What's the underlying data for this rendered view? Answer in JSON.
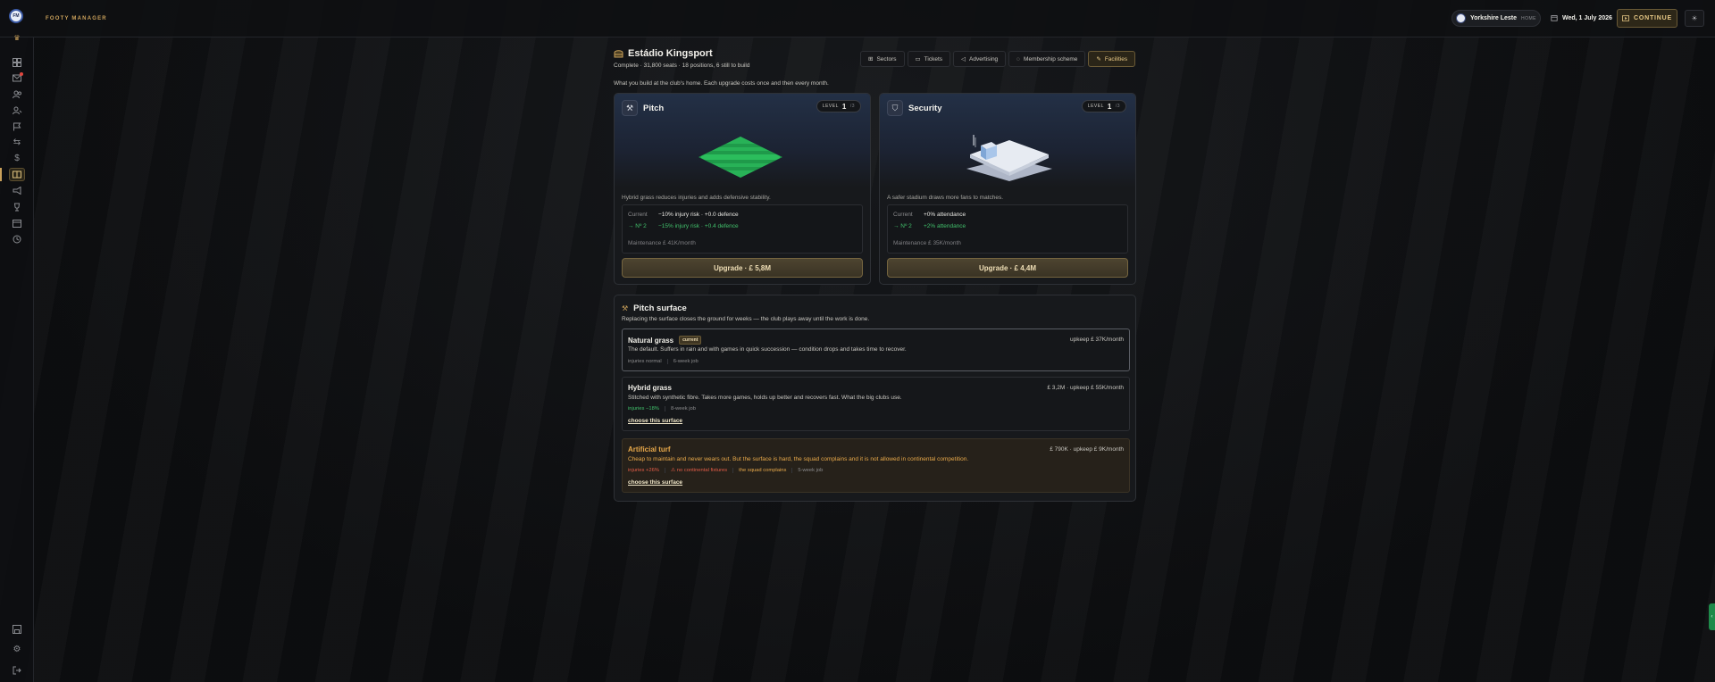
{
  "app": {
    "brand": "FOOTY MANAGER",
    "logo_text": "FM"
  },
  "header": {
    "club_name": "Yorkshire Leste",
    "club_tag": "HOME",
    "date": "Wed, 1 July 2026",
    "continue_label": "CONTINUE"
  },
  "page": {
    "title": "Estádio Kingsport",
    "subtitle": "Complete · 31,800 seats · 18 positions, 6 still to build",
    "intro": "What you build at the club's home. Each upgrade costs once and then every month."
  },
  "tabs": [
    {
      "label": "Sectors",
      "icon": "sectors-icon"
    },
    {
      "label": "Tickets",
      "icon": "ticket-icon"
    },
    {
      "label": "Advertising",
      "icon": "megaphone-icon"
    },
    {
      "label": "Membership scheme",
      "icon": "members-icon"
    },
    {
      "label": "Facilities",
      "icon": "tools-icon",
      "active": true
    }
  ],
  "cards": [
    {
      "title": "Pitch",
      "level_label": "LEVEL",
      "level": "1",
      "level_max": "/3",
      "description": "Hybrid grass reduces injuries and adds defensive stability.",
      "current_label": "Current",
      "current_value": "−10% injury risk · +0.0 defence",
      "next_label": "→ Nº 2",
      "next_value": "−15% injury risk · +0.4 defence",
      "maintenance": "Maintenance £ 41K/month",
      "upgrade_label": "Upgrade · £ 5,8M"
    },
    {
      "title": "Security",
      "level_label": "LEVEL",
      "level": "1",
      "level_max": "/3",
      "description": "A safer stadium draws more fans to matches.",
      "current_label": "Current",
      "current_value": "+0% attendance",
      "next_label": "→ Nº 2",
      "next_value": "+2% attendance",
      "maintenance": "Maintenance £ 35K/month",
      "upgrade_label": "Upgrade · £ 4,4M"
    }
  ],
  "surface": {
    "title": "Pitch surface",
    "subtitle": "Replacing the surface closes the ground for weeks — the club plays away until the work is done.",
    "options": [
      {
        "name": "Natural grass",
        "badge": "current",
        "price": "upkeep £ 37K/month",
        "description": "The default. Suffers in rain and with games in quick succession — condition drops and takes time to recover.",
        "tags": [
          "injuries normal",
          "6-week job"
        ]
      },
      {
        "name": "Hybrid grass",
        "price": "£ 3,2M · upkeep £ 55K/month",
        "description": "Stitched with synthetic fibre. Takes more games, holds up better and recovers fast. What the big clubs use.",
        "tags": [
          "injuries −18%",
          "8-week job"
        ],
        "choose_label": "choose this surface"
      },
      {
        "name": "Artificial turf",
        "price": "£ 790K · upkeep £ 9K/month",
        "description": "Cheap to maintain and never wears out. But the surface is hard, the squad complains and it is not allowed in continental competition.",
        "tags": [
          "injuries +26%",
          "⚠ no continental fixtures",
          "the squad complains",
          "5-week job"
        ],
        "choose_label": "choose this surface"
      }
    ]
  },
  "colors": {
    "accent": "#c9a05a",
    "good": "#41c06b",
    "bad": "#e35c47",
    "warn": "#e8a94a"
  }
}
